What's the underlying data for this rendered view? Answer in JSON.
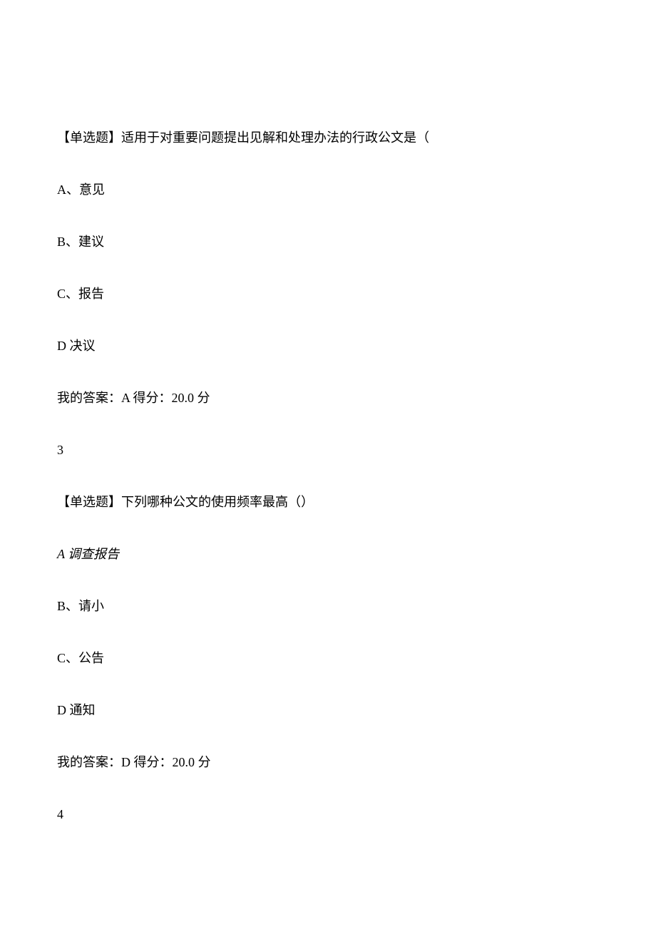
{
  "q2": {
    "stem": "【单选题】适用于对重要问题提出见解和处理办法的行政公文是（",
    "optA": "A、意见",
    "optB": "B、建议",
    "optC": "C、报告",
    "optD": "D 决议",
    "answer": "我的答案：A 得分：20.0 分"
  },
  "q3": {
    "number": "3",
    "stem": "【单选题】下列哪种公文的使用频率最高（）",
    "optA": "A 调查报告",
    "optB": "B、请小",
    "optC": "C、公告",
    "optD": "D 通知",
    "answer": "我的答案：D 得分：20.0 分"
  },
  "q4": {
    "number": "4"
  }
}
